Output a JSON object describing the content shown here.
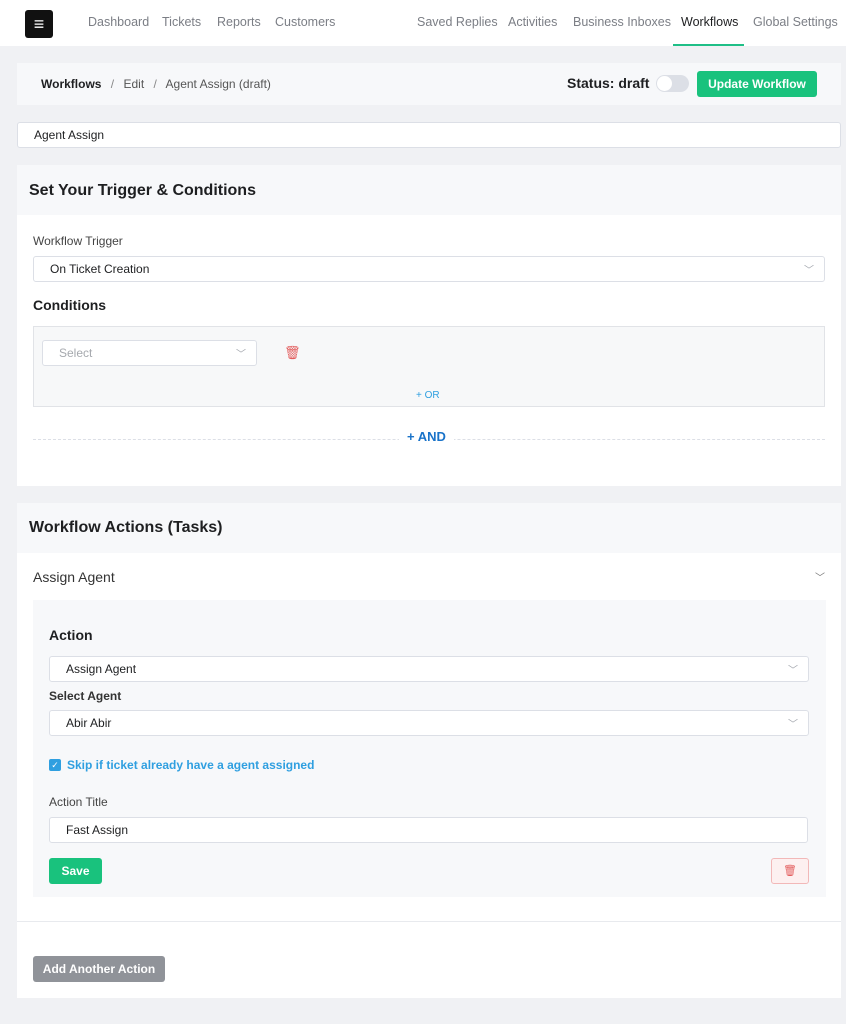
{
  "nav": {
    "left": [
      "Dashboard",
      "Tickets",
      "Reports",
      "Customers"
    ],
    "right": [
      "Saved Replies",
      "Activities",
      "Business Inboxes",
      "Workflows",
      "Global Settings"
    ],
    "active": "Workflows"
  },
  "breadcrumb": {
    "root": "Workflows",
    "edit": "Edit",
    "current": "Agent Assign (draft)",
    "sep": "/"
  },
  "status": {
    "label": "Status: draft",
    "enabled": false
  },
  "update_button": "Update Workflow",
  "workflow_name": "Agent Assign",
  "trigger_section": {
    "title": "Set Your Trigger & Conditions",
    "trigger_label": "Workflow Trigger",
    "trigger_value": "On Ticket Creation",
    "conditions_label": "Conditions",
    "condition_placeholder": "Select",
    "or_label": "OR",
    "and_label": "AND"
  },
  "actions_section": {
    "title": "Workflow Actions (Tasks)",
    "task_title": "Assign Agent",
    "action_label": "Action",
    "action_value": "Assign Agent",
    "agent_label": "Select Agent",
    "agent_value": "Abir Abir",
    "skip_label": "Skip if ticket already have a agent assigned",
    "skip_checked": true,
    "action_title_label": "Action Title",
    "action_title_value": "Fast Assign",
    "save": "Save",
    "add_another": "Add Another Action"
  },
  "colors": {
    "accent": "#19c27d",
    "link": "#2f9fe0",
    "danger": "#e35d5d"
  }
}
